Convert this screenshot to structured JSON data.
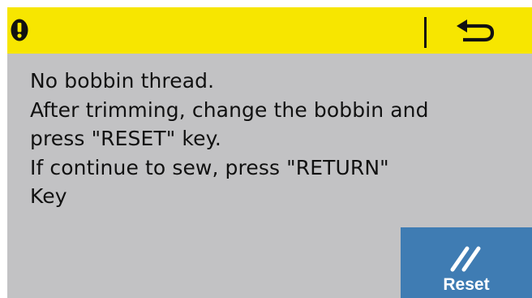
{
  "header": {
    "warning_icon": "exclamation-circle-icon",
    "return_icon": "return-arrow-icon",
    "background_color": "#f7e600"
  },
  "message": {
    "lines": [
      "No bobbin thread.",
      "After trimming, change the bobbin and",
      "press \"RESET\" key.",
      "If continue to sew, press \"RETURN\"",
      "Key"
    ]
  },
  "reset_button": {
    "label": "Reset",
    "icon": "double-slash-icon",
    "color": "#3f7cb3"
  },
  "panel": {
    "background_color": "#c2c2c4"
  }
}
